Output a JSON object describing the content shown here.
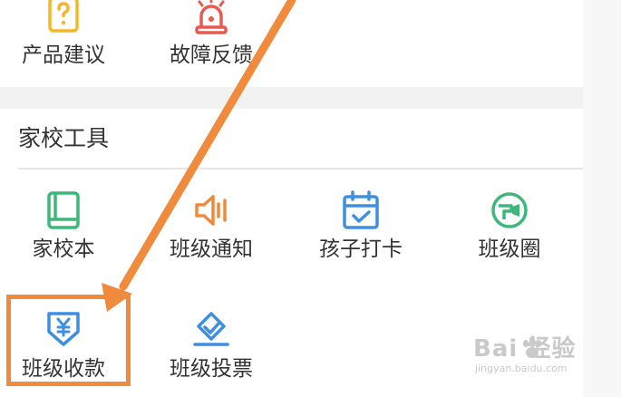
{
  "top_section": {
    "items": [
      {
        "label": "产品建议",
        "icon": "suggestion-icon"
      },
      {
        "label": "故障反馈",
        "icon": "alarm-icon"
      }
    ]
  },
  "home_school_tools": {
    "title": "家校工具",
    "items": [
      {
        "label": "家校本",
        "icon": "book-icon"
      },
      {
        "label": "班级通知",
        "icon": "megaphone-icon"
      },
      {
        "label": "孩子打卡",
        "icon": "calendar-check-icon"
      },
      {
        "label": "班级圈",
        "icon": "class-circle-icon"
      },
      {
        "label": "班级收款",
        "icon": "yuan-payment-icon"
      },
      {
        "label": "班级投票",
        "icon": "vote-icon"
      }
    ]
  },
  "watermark": {
    "main": "Bai 经验",
    "sub": "jingyan.baidu.com"
  },
  "colors": {
    "accent_orange": "#f08a3c",
    "icon_green": "#3db77a",
    "icon_blue": "#3f8fe0",
    "icon_red": "#e85a4f",
    "icon_yellow": "#f5b62a"
  }
}
